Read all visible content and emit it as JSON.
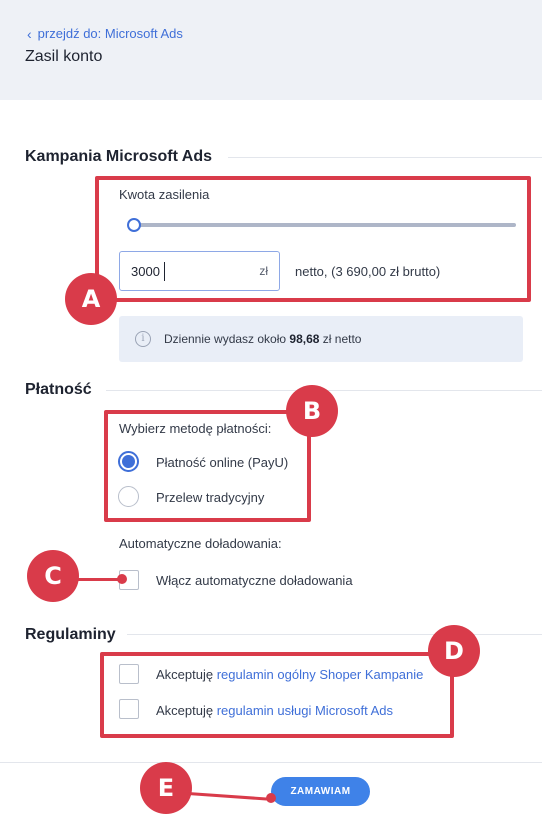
{
  "header": {
    "back_link": "przejdź do: Microsoft Ads",
    "title": "Zasil konto"
  },
  "campaign": {
    "section_title": "Kampania Microsoft Ads",
    "amount_label": "Kwota zasilenia",
    "slider_level": 0.0,
    "amount_value": "3000",
    "amount_unit": "zł",
    "netto_text": "netto, (3 690,00 zł brutto)",
    "info_prefix": "Dziennie wydasz około ",
    "info_amount": "98,68",
    "info_suffix": " zł netto"
  },
  "payment": {
    "section_title": "Płatność",
    "method_label": "Wybierz metodę płatności:",
    "options": [
      {
        "label": "Płatność online (PayU)",
        "selected": true
      },
      {
        "label": "Przelew tradycyjny",
        "selected": false
      }
    ],
    "auto_label": "Automatyczne doładowania:",
    "auto_option": "Włącz automatyczne doładowania"
  },
  "terms": {
    "section_title": "Regulaminy",
    "items": [
      {
        "prefix": "Akceptuję ",
        "link": "regulamin ogólny Shoper Kampanie"
      },
      {
        "prefix": "Akceptuję ",
        "link": "regulamin usługi Microsoft Ads"
      }
    ]
  },
  "footer": {
    "submit_label": "ZAMAWIAM"
  },
  "annotations": {
    "a": "A",
    "b": "B",
    "c": "C",
    "d": "D",
    "e": "E"
  },
  "colors": {
    "accent": "#3f6fd8",
    "annotation": "#d93b4a",
    "button": "#3f82e8"
  }
}
